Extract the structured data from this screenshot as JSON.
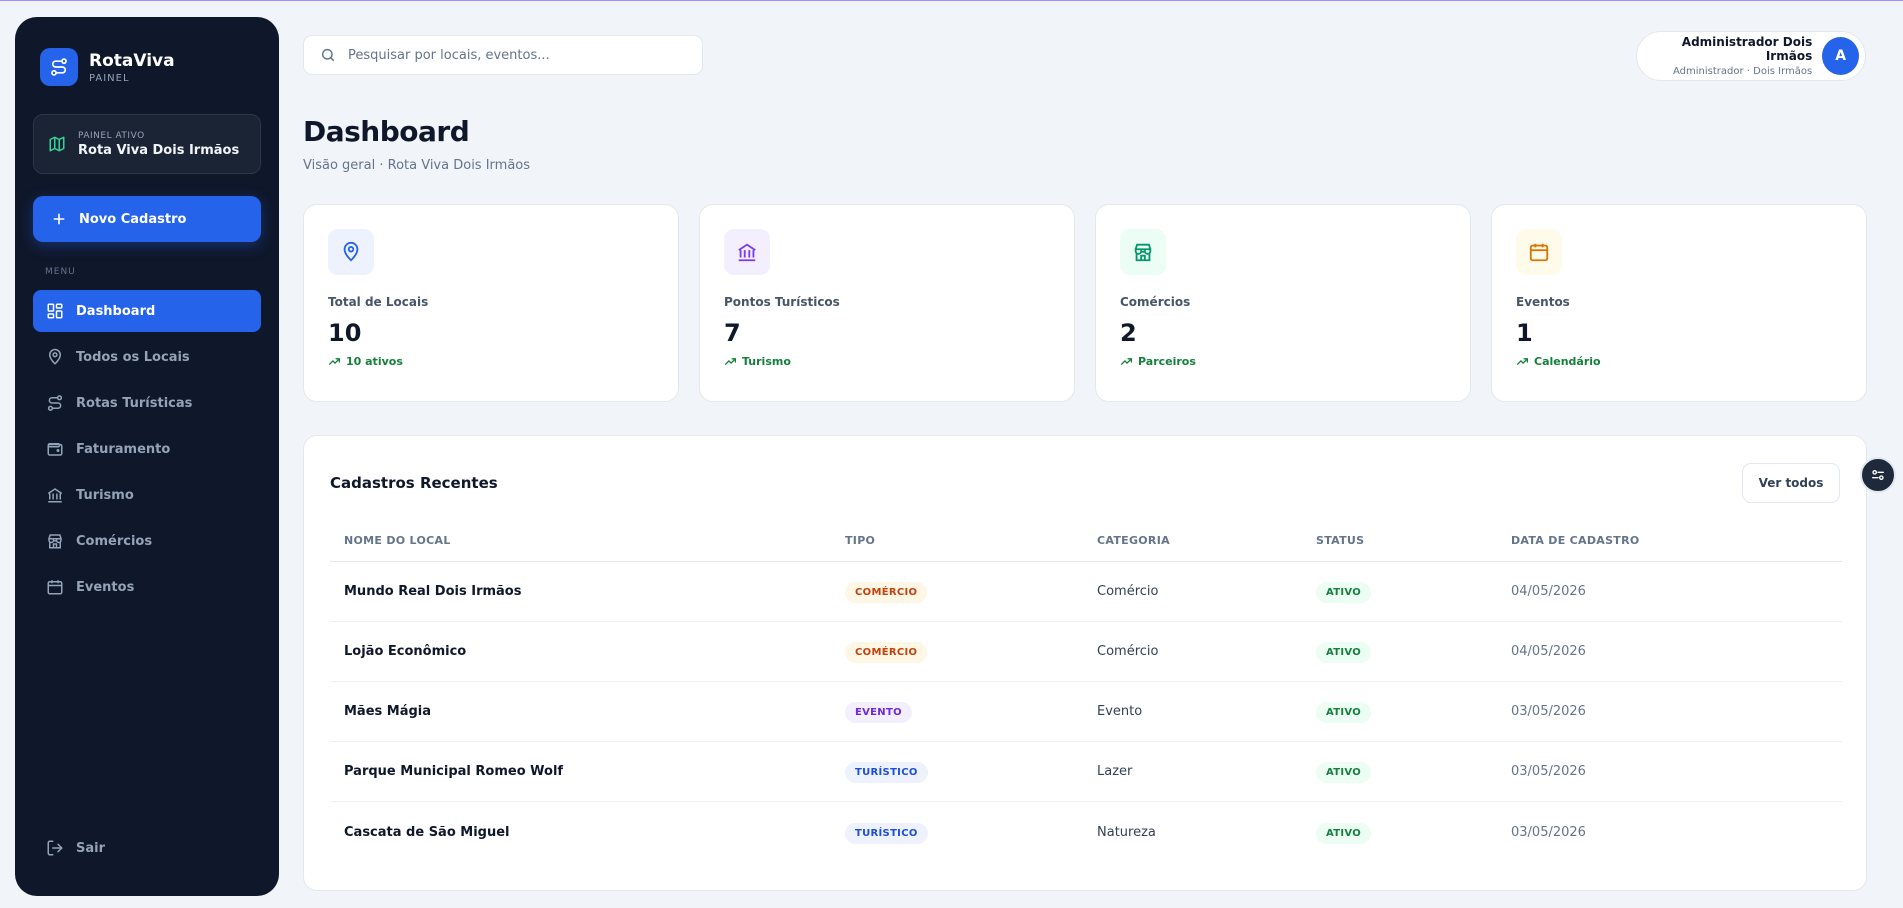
{
  "brand": {
    "name": "RotaViva",
    "subtitle": "PAINEL"
  },
  "active_panel": {
    "label": "PAINEL ATIVO",
    "value": "Rota Viva Dois Irmãos"
  },
  "new_button": {
    "label": "Novo Cadastro"
  },
  "menu_label": "MENU",
  "nav": [
    {
      "label": "Dashboard",
      "icon": "dashboard-icon",
      "active": true
    },
    {
      "label": "Todos os Locais",
      "icon": "map-pin-icon"
    },
    {
      "label": "Rotas Turísticas",
      "icon": "route-icon"
    },
    {
      "label": "Faturamento",
      "icon": "wallet-icon"
    },
    {
      "label": "Turismo",
      "icon": "landmark-icon"
    },
    {
      "label": "Comércios",
      "icon": "store-icon"
    },
    {
      "label": "Eventos",
      "icon": "calendar-icon"
    }
  ],
  "logout_label": "Sair",
  "search": {
    "placeholder": "Pesquisar por locais, eventos..."
  },
  "user": {
    "name": "Administrador Dois Irmãos",
    "role": "Administrador · Dois Irmãos",
    "initial": "A"
  },
  "page": {
    "title": "Dashboard",
    "subtitle": "Visão geral · Rota Viva Dois Irmãos"
  },
  "stats": [
    {
      "label": "Total de Locais",
      "value": "10",
      "trend": "10 ativos",
      "icon": "map-pin-icon",
      "color": "#2563eb",
      "bg": "#eef2ff"
    },
    {
      "label": "Pontos Turísticos",
      "value": "7",
      "trend": "Turismo",
      "icon": "landmark-icon",
      "color": "#7c3aed",
      "bg": "#f3efff"
    },
    {
      "label": "Comércios",
      "value": "2",
      "trend": "Parceiros",
      "icon": "store-icon",
      "color": "#059669",
      "bg": "#ecfdf5"
    },
    {
      "label": "Eventos",
      "value": "1",
      "trend": "Calendário",
      "icon": "calendar-icon",
      "color": "#d97706",
      "bg": "#fffbeb"
    }
  ],
  "recent": {
    "title": "Cadastros Recentes",
    "view_all": "Ver todos",
    "columns": [
      "NOME DO LOCAL",
      "TIPO",
      "CATEGORIA",
      "STATUS",
      "DATA DE CADASTRO"
    ],
    "rows": [
      {
        "name": "Mundo Real Dois Irmãos",
        "type": "COMÉRCIO",
        "type_key": "comercio",
        "category": "Comércio",
        "status": "ATIVO",
        "date": "04/05/2026"
      },
      {
        "name": "Lojão Econômico",
        "type": "COMÉRCIO",
        "type_key": "comercio",
        "category": "Comércio",
        "status": "ATIVO",
        "date": "04/05/2026"
      },
      {
        "name": "Mães Mágia",
        "type": "EVENTO",
        "type_key": "evento",
        "category": "Evento",
        "status": "ATIVO",
        "date": "03/05/2026"
      },
      {
        "name": "Parque Municipal Romeo Wolf",
        "type": "TURÍSTICO",
        "type_key": "turistico",
        "category": "Lazer",
        "status": "ATIVO",
        "date": "03/05/2026"
      },
      {
        "name": "Cascata de São Miguel",
        "type": "TURÍSTICO",
        "type_key": "turistico",
        "category": "Natureza",
        "status": "ATIVO",
        "date": "03/05/2026"
      }
    ]
  },
  "colors": {
    "primary": "#2563eb",
    "sidebar": "#0f172a",
    "success": "#15803d"
  }
}
